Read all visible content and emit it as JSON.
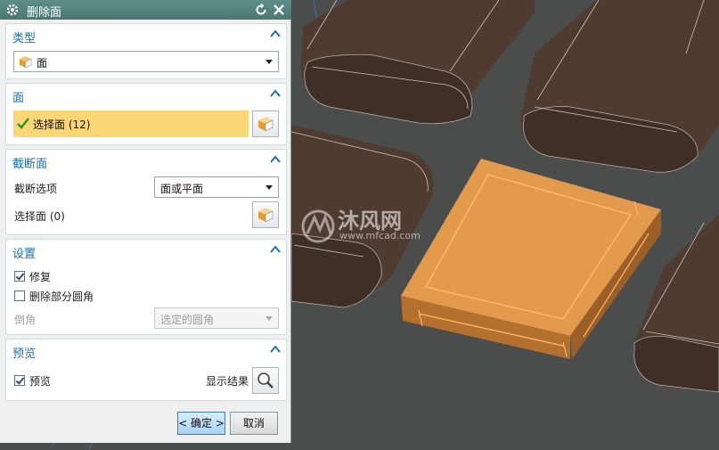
{
  "dialog": {
    "title": "删除面",
    "sections": {
      "type": {
        "header": "类型",
        "selected": "面"
      },
      "face": {
        "header": "面",
        "select_label": "选择面 (12)"
      },
      "cutoff": {
        "header": "截断面",
        "option_label": "截断选项",
        "option_value": "面或平面",
        "select_label": "选择面 (0)"
      },
      "settings": {
        "header": "设置",
        "repair_label": "修复",
        "repair_checked": true,
        "delete_partial_fillet_label": "删除部分圆角",
        "delete_partial_fillet_checked": false,
        "chamfer_label": "倒角",
        "chamfer_value": "选定的圆角"
      },
      "preview": {
        "header": "预览",
        "preview_label": "预览",
        "preview_checked": true,
        "show_result_label": "显示结果"
      }
    },
    "buttons": {
      "ok": "< 确定 >",
      "cancel": "取消"
    }
  },
  "watermark": {
    "brand": "沐风网",
    "url": "www.mfcad.com"
  },
  "colors": {
    "title_bar": "#5a8884",
    "section_header_text": "#1c6fb0",
    "highlight_row": "#fbd675",
    "selected_face": "#e39a4c",
    "viewport_bg": "#4a4d4b",
    "block_brown": "#4d3a2e"
  }
}
